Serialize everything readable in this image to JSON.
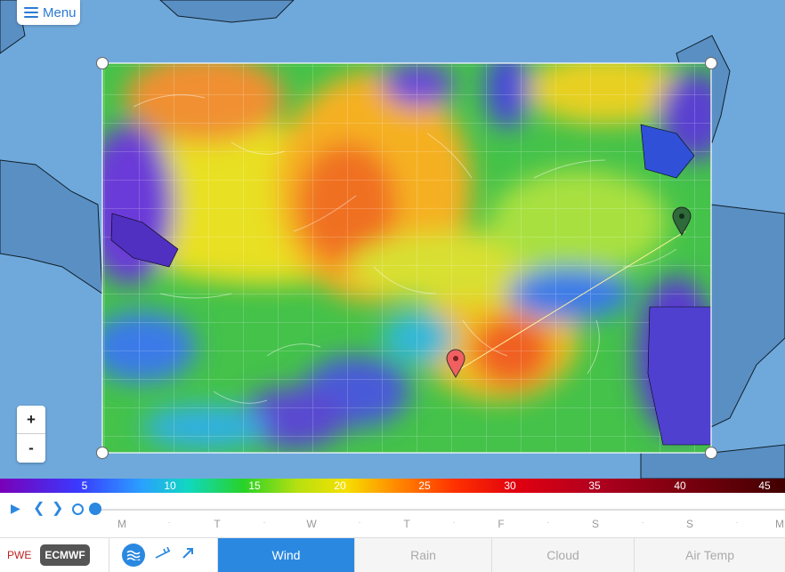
{
  "header": {
    "menu_label": "Menu",
    "menu_icon": "hamburger-icon"
  },
  "map": {
    "layer": "wind speed",
    "waypoints": [
      {
        "name": "start-marker",
        "color": "#f06060"
      },
      {
        "name": "end-marker",
        "color": "#2f6a3a"
      }
    ],
    "zoom": {
      "in_label": "+",
      "out_label": "-"
    }
  },
  "legend": {
    "ticks": [
      "5",
      "10",
      "15",
      "20",
      "25",
      "30",
      "35",
      "40",
      "45"
    ]
  },
  "timeline": {
    "days": [
      "M",
      "T",
      "W",
      "T",
      "F",
      "S",
      "S",
      "M"
    ],
    "separator": "·"
  },
  "bottom": {
    "sources": {
      "pwe": "PWE",
      "ecmwf": "ECMWF"
    },
    "tabs": {
      "wind": "Wind",
      "rain": "Rain",
      "cloud": "Cloud",
      "air_temp": "Air Temp"
    }
  },
  "colors": {
    "accent": "#2a88e0",
    "pwe": "#c02020"
  }
}
